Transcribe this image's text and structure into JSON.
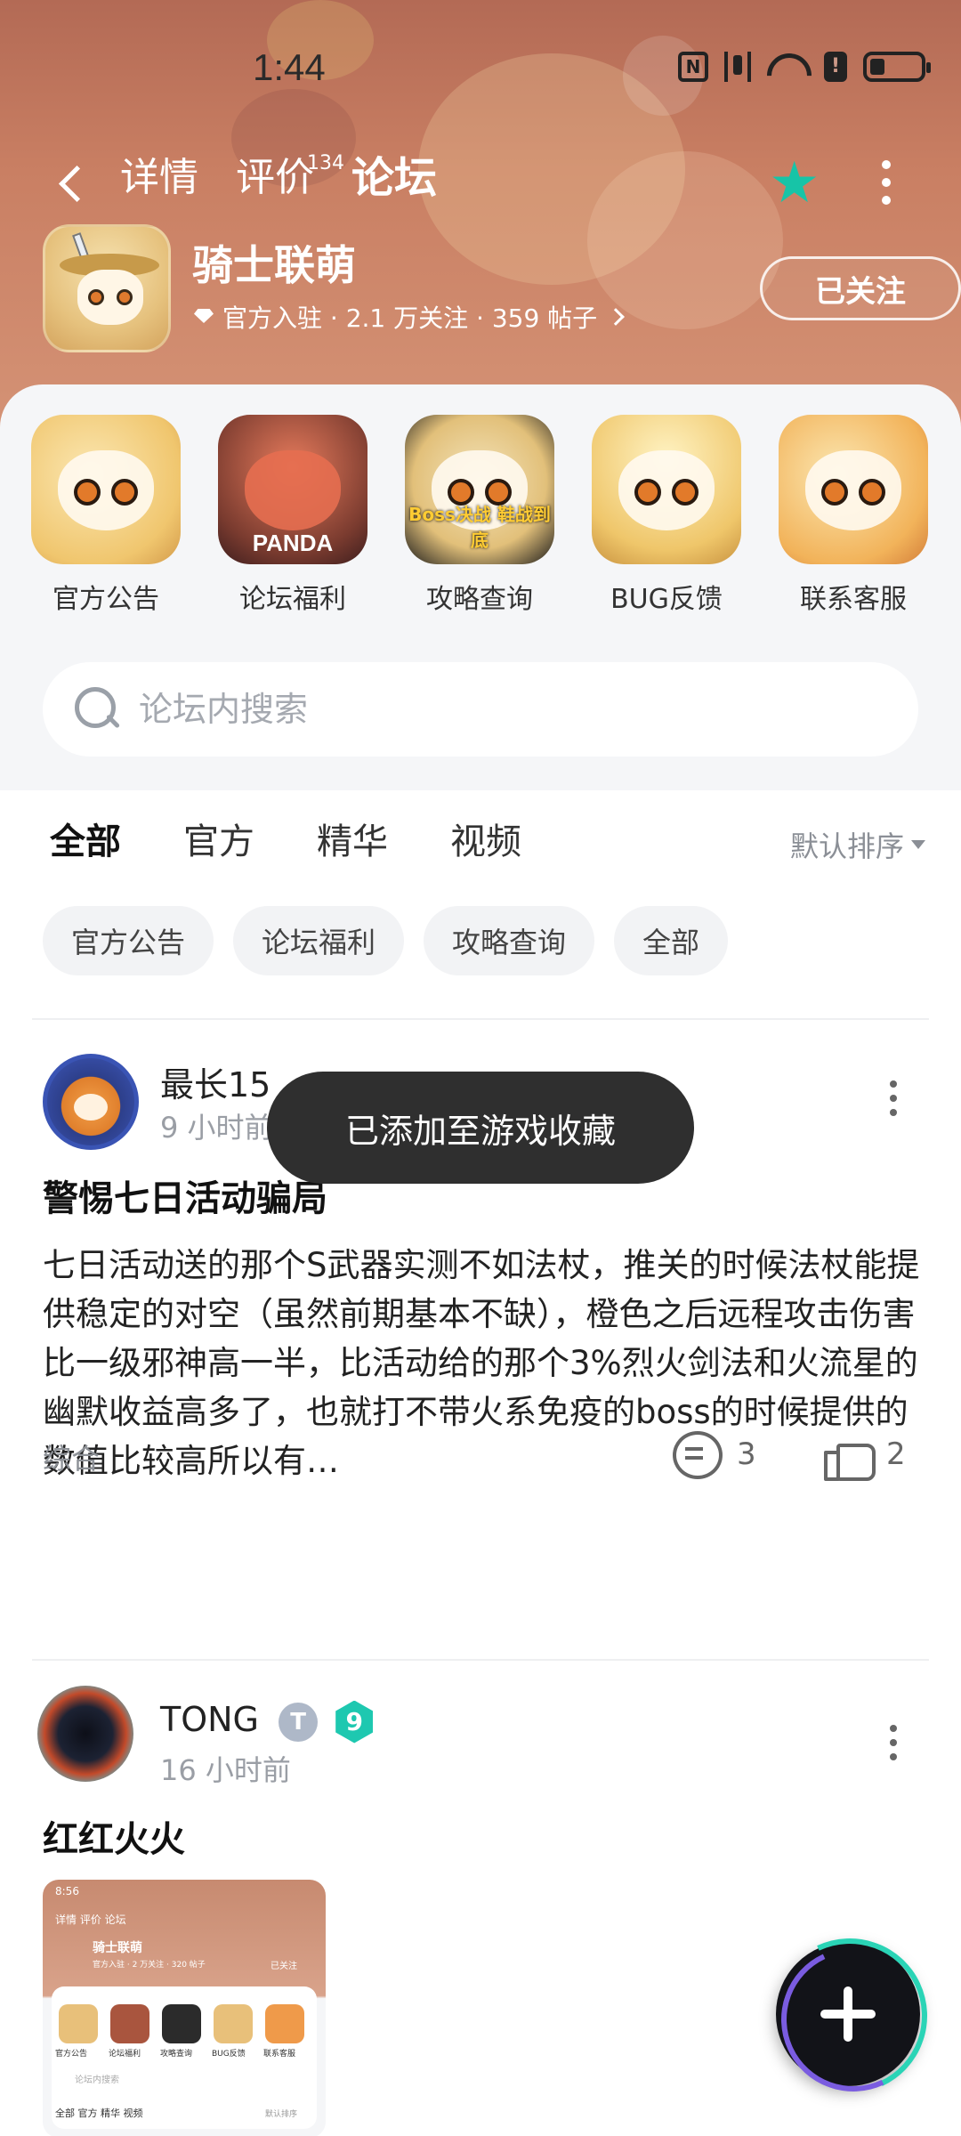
{
  "status_bar": {
    "time": "1:44"
  },
  "nav": {
    "tabs": [
      {
        "label": "详情"
      },
      {
        "label": "评价",
        "count": "134"
      },
      {
        "label": "论坛"
      }
    ],
    "active_tab": "论坛"
  },
  "game": {
    "name": "骑士联萌",
    "meta": "官方入驻 · 2.1 万关注 · 359 帖子",
    "follow_label": "已关注"
  },
  "quick_links": [
    {
      "label": "官方公告"
    },
    {
      "label": "论坛福利",
      "image_text": "PANDA"
    },
    {
      "label": "攻略查询",
      "image_text": "Boss决战 鞋战到底"
    },
    {
      "label": "BUG反馈"
    },
    {
      "label": "联系客服"
    }
  ],
  "search": {
    "placeholder": "论坛内搜索"
  },
  "filter_tabs": [
    "全部",
    "官方",
    "精华",
    "视频"
  ],
  "sort_label": "默认排序",
  "chips": [
    "官方公告",
    "论坛福利",
    "攻略查询",
    "全部"
  ],
  "toast": "已添加至游戏收藏",
  "posts": [
    {
      "author": "最长15",
      "time": "9 小时前",
      "title": "警惕七日活动骗局",
      "body": "七日活动送的那个S武器实测不如法杖，推关的时候法杖能提供稳定的对空（虽然前期基本不缺），橙色之后远程攻击伤害比一级邪神高一半，比活动给的那个3%烈火剑法和火流星的幽默收益高多了，也就打不带火系免疫的boss的时候提供的数值比较高所以有…",
      "tag": "综合",
      "comments": "3",
      "likes": "2"
    },
    {
      "author": "TONG",
      "badge": "T",
      "level": "9",
      "time": "16 小时前",
      "title": "红红火火",
      "thumb": {
        "time": "8:56",
        "tabs": "详情  评价  论坛",
        "name": "骑士联萌",
        "meta": "官方入驻 · 2 万关注 · 320 帖子",
        "follow": "已关注",
        "labels": [
          "官方公告",
          "论坛福利",
          "攻略查询",
          "BUG反馈",
          "联系客服"
        ],
        "search": "论坛内搜索",
        "filters": "全部  官方  精华  视频",
        "sort": "默认排序"
      }
    }
  ],
  "colors": {
    "accent": "#2ad4b6",
    "banner": "#c97f63",
    "toast_bg": "#2f2f2f"
  }
}
